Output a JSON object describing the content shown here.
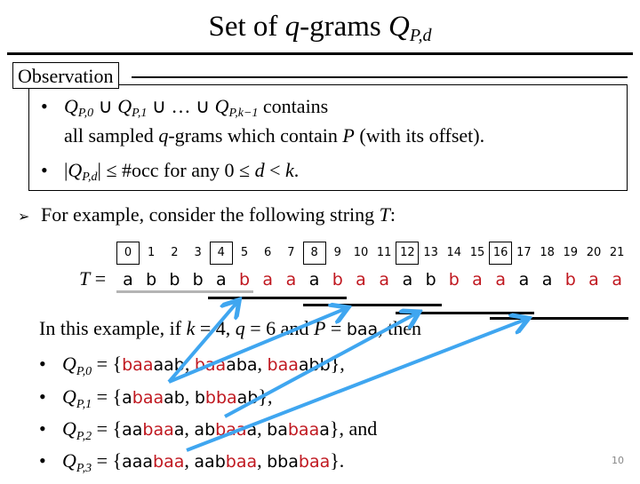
{
  "slide": {
    "title": {
      "prefix": "Set of ",
      "q": "q",
      "middle": "-grams ",
      "symbol": "Q",
      "subscript": "P,d"
    },
    "observation": {
      "label": "Observation",
      "bullet1": {
        "line1_parts": [
          "Q",
          "P,0",
          " ∪ ",
          "Q",
          "P,1",
          " ∪ … ∪ ",
          "Q",
          "P,k−1",
          " contains"
        ],
        "line2_prefix": "all sampled ",
        "line2_q": "q",
        "line2_mid": "-grams which contain ",
        "line2_P": "P",
        "line2_suffix": " (with its offset)."
      },
      "bullet2": {
        "abs_open": "|",
        "symbol": "Q",
        "subscript": "P,d",
        "abs_close": "|",
        "text": " ≤ #occ  for any 0 ≤ ",
        "d": "d",
        "lt": " < ",
        "k": "k",
        "end": "."
      }
    },
    "example_intro": {
      "bullet_icon": "arrow-bullet-icon",
      "text": "For example, consider the following string ",
      "T": "T",
      "colon": ":"
    },
    "string_T": {
      "label": "T",
      "equals": " =",
      "indices": [
        "0",
        "1",
        "2",
        "3",
        "4",
        "5",
        "6",
        "7",
        "8",
        "9",
        "10",
        "11",
        "12",
        "13",
        "14",
        "15",
        "16",
        "17",
        "18",
        "19",
        "20",
        "21"
      ],
      "boxed_indices": [
        0,
        4,
        8,
        12,
        16
      ],
      "chars": [
        "a",
        "b",
        "b",
        "b",
        "a",
        "b",
        "a",
        "a",
        "a",
        "b",
        "a",
        "a",
        "a",
        "b",
        "b",
        "a",
        "a",
        "a",
        "a",
        "b",
        "a",
        "a"
      ],
      "red_positions": [
        5,
        6,
        7,
        9,
        10,
        11,
        14,
        15,
        16,
        19,
        20,
        21
      ]
    },
    "lower": {
      "intro": {
        "prefix": "In this example, if ",
        "k": "k",
        "k_eq": " = 4, ",
        "q": "q",
        "q_eq": " = 6 and ",
        "P": "P",
        "P_eq": " = ",
        "P_val": "baa",
        "suffix": ", then"
      },
      "sets": [
        {
          "symbol": "Q",
          "subscript": "P,0",
          "eq": " = {",
          "items": [
            [
              {
                "t": "baa",
                "red": true
              },
              {
                "t": "aab",
                "red": false
              }
            ],
            [
              {
                "t": "baa",
                "red": true
              },
              {
                "t": "aba",
                "red": false
              }
            ],
            [
              {
                "t": "baa",
                "red": true
              },
              {
                "t": "abb",
                "red": false
              }
            ]
          ],
          "close": "},"
        },
        {
          "symbol": "Q",
          "subscript": "P,1",
          "eq": " = {",
          "items": [
            [
              {
                "t": "a",
                "red": false
              },
              {
                "t": "baa",
                "red": true
              },
              {
                "t": "ab",
                "red": false
              }
            ],
            [
              {
                "t": "b",
                "red": false
              },
              {
                "t": "bba",
                "red": true
              },
              {
                "t": "ab",
                "red": false
              }
            ]
          ],
          "close": "},"
        },
        {
          "symbol": "Q",
          "subscript": "P,2",
          "eq": " = {",
          "items": [
            [
              {
                "t": "aa",
                "red": false
              },
              {
                "t": "baa",
                "red": true
              },
              {
                "t": "a",
                "red": false
              }
            ],
            [
              {
                "t": "ab",
                "red": false
              },
              {
                "t": "baa",
                "red": true
              },
              {
                "t": "a",
                "red": false
              }
            ],
            [
              {
                "t": "ba",
                "red": false
              },
              {
                "t": "baa",
                "red": true
              },
              {
                "t": "a",
                "red": false
              }
            ]
          ],
          "close": "}, and"
        },
        {
          "symbol": "Q",
          "subscript": "P,3",
          "eq": " = {",
          "items": [
            [
              {
                "t": "aaa",
                "red": false
              },
              {
                "t": "baa",
                "red": true
              }
            ],
            [
              {
                "t": "aab",
                "red": false
              },
              {
                "t": "baa",
                "red": true
              }
            ],
            [
              {
                "t": "bba",
                "red": false
              },
              {
                "t": "baa",
                "red": true
              }
            ]
          ],
          "close": "}."
        }
      ]
    },
    "page_number": "10",
    "colors": {
      "highlight_red": "#c01820",
      "arrow_blue": "#3fa6f0",
      "window_gray": "#b4b4b4",
      "text": "#000000"
    }
  }
}
